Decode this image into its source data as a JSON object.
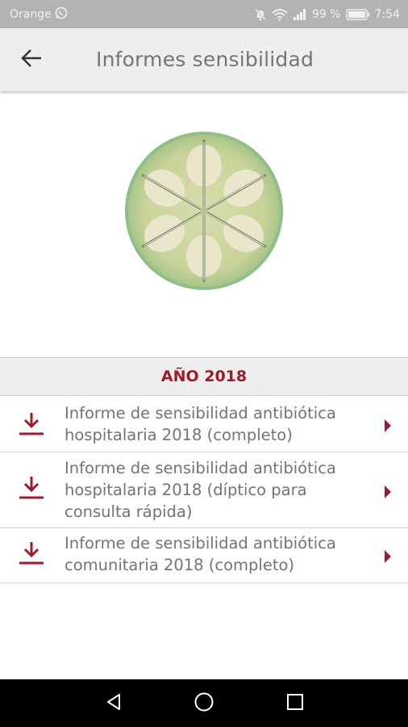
{
  "status_bar": {
    "carrier": "Orange",
    "battery": "99 %",
    "time": "7:54",
    "icons": [
      "whatsapp-icon",
      "mute-icon",
      "wifi-icon",
      "signal-icon",
      "battery-icon"
    ]
  },
  "app_bar": {
    "title": "Informes sensibilidad",
    "back_icon": "arrow-left-icon"
  },
  "hero_image": {
    "description_icon": "petri-dish-image"
  },
  "section": {
    "title": "AÑO 2018"
  },
  "items": [
    {
      "line1": "Informe de sensibilidad antibiótica",
      "line2": "hospitalaria 2018 (completo)",
      "line3": ""
    },
    {
      "line1": "Informe de sensibilidad antibiótica",
      "line2": "hospitalaria 2018 (díptico para",
      "line3": "consulta rápida)"
    },
    {
      "line1": "Informe de sensibilidad antibiótica",
      "line2": "comunitaria 2018 (completo)",
      "line3": ""
    }
  ],
  "colors": {
    "accent": "#9c1c2c",
    "status_bar": "#b3b3b3",
    "app_bar": "#eeeeee",
    "text": "#737373"
  },
  "nav_bar": {
    "icons": [
      "back-triangle-icon",
      "home-circle-icon",
      "recents-square-icon"
    ]
  }
}
